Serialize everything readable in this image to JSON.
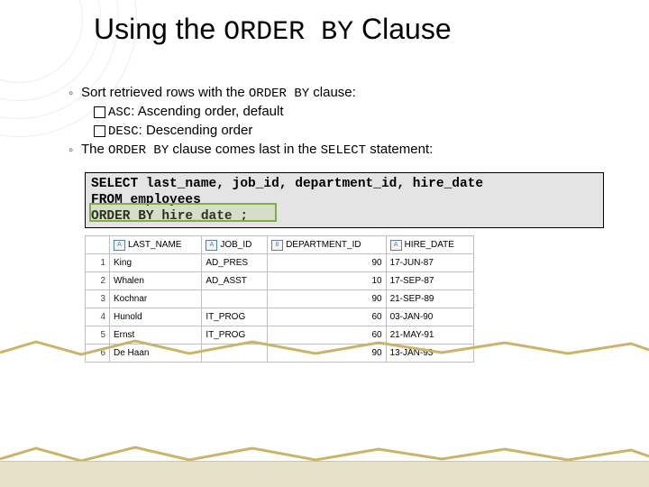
{
  "title": {
    "pre": "Using the ",
    "code": "ORDER BY",
    "post": " Clause"
  },
  "bullets": {
    "b1": {
      "pre": "Sort retrieved rows with the ",
      "code": "ORDER BY",
      "post": " clause:"
    },
    "s1": {
      "code": "ASC",
      "post": ": Ascending order, default"
    },
    "s2": {
      "code": "DESC",
      "post": ": Descending order"
    },
    "b2": {
      "pre": "The ",
      "code1": "ORDER BY",
      "mid": " clause comes last in the ",
      "code2": "SELECT",
      "post": " statement:"
    }
  },
  "code": {
    "l1": "SELECT   last_name, job_id, department_id, hire_date",
    "l2": "FROM     employees",
    "l3a": "ORDER BY hire_date",
    "l3b": " ;"
  },
  "table": {
    "headers": {
      "c1a": "A",
      "c1": "LAST_NAME",
      "c2a": "A",
      "c2": "JOB_ID",
      "c3a": "8",
      "c3": "DEPARTMENT_ID",
      "c4a": "A",
      "c4": "HIRE_DATE"
    },
    "rows": [
      {
        "n": "1",
        "last": "King",
        "job": "AD_PRES",
        "dept": "90",
        "hire": "17-JUN-87"
      },
      {
        "n": "2",
        "last": "Whalen",
        "job": "AD_ASST",
        "dept": "10",
        "hire": "17-SEP-87"
      },
      {
        "n": "3",
        "last": "Kochnar",
        "job": "",
        "dept": "90",
        "hire": "21-SEP-89"
      },
      {
        "n": "4",
        "last": "Hunold",
        "job": "IT_PROG",
        "dept": "60",
        "hire": "03-JAN-90"
      },
      {
        "n": "5",
        "last": "Ernst",
        "job": "IT_PROG",
        "dept": "60",
        "hire": "21-MAY-91"
      },
      {
        "n": "6",
        "last": "De Haan",
        "job": "",
        "dept": "90",
        "hire": "13-JAN-93"
      }
    ]
  }
}
